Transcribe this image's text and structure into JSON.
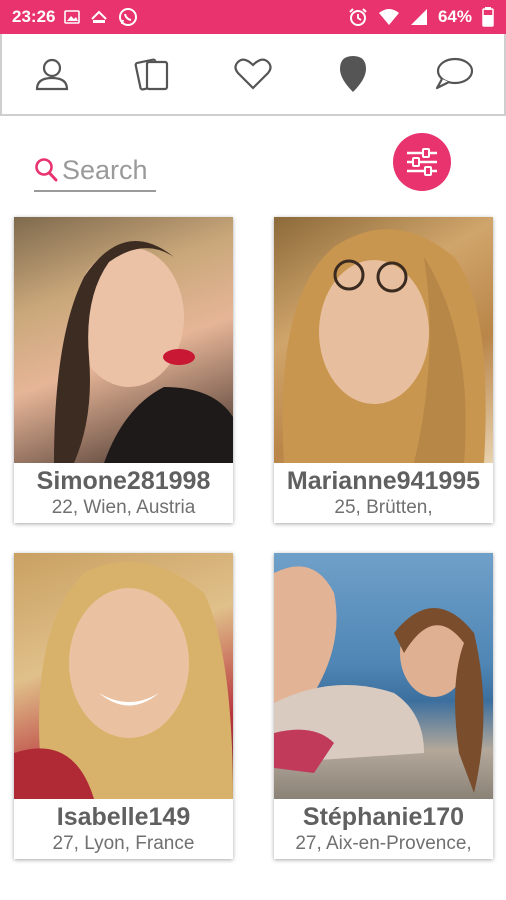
{
  "status_bar": {
    "time": "23:26",
    "battery": "64%",
    "bg_color": "#e8336e"
  },
  "nav": {
    "items": [
      {
        "icon": "profile-icon"
      },
      {
        "icon": "cards-icon"
      },
      {
        "icon": "heart-icon"
      },
      {
        "icon": "location-pin-icon"
      },
      {
        "icon": "chat-bubble-icon"
      }
    ]
  },
  "search": {
    "placeholder": "Search"
  },
  "filter": {
    "icon": "sliders-icon",
    "color": "#e8336e"
  },
  "profiles": [
    {
      "name": "Simone281998",
      "info": "22, Wien, Austria"
    },
    {
      "name": "Marianne941995",
      "info": "25, Brütten,"
    },
    {
      "name": "Isabelle149",
      "info": "27, Lyon, France"
    },
    {
      "name": "Stéphanie170",
      "info": "27, Aix-en-Provence,"
    }
  ]
}
